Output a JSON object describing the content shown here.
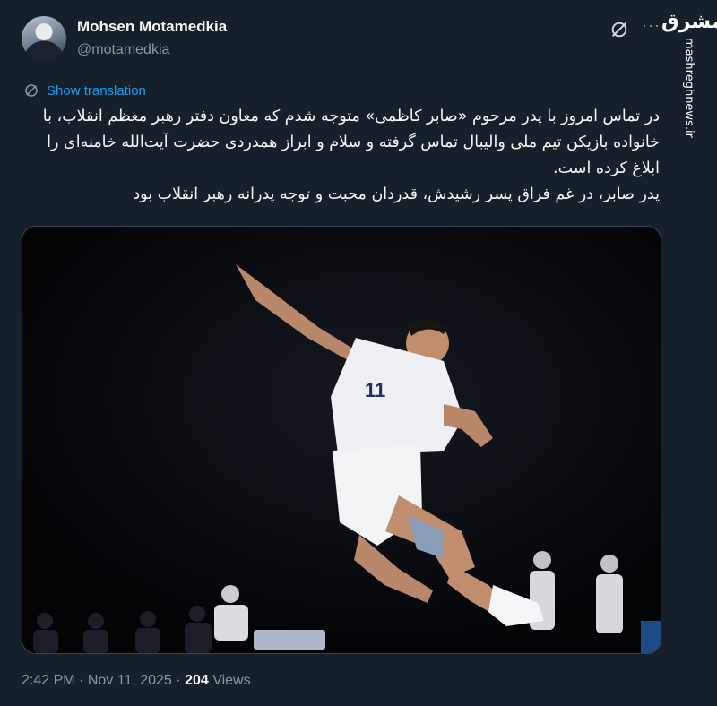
{
  "author": {
    "name": "Mohsen Motamedkia",
    "handle": "@motamedkia"
  },
  "watermark": {
    "logo": "مشرق",
    "site": "mashreghnews.ir"
  },
  "actions": {
    "grok_icon": "grok-icon",
    "more_icon": "more-icon",
    "more_label": "···"
  },
  "translate": {
    "icon": "globe-icon",
    "label": "Show translation"
  },
  "tweet": {
    "paragraph1": "در تماس امروز با پدر مرحوم «صابر کاظمی» متوجه شدم که معاون دفتر رهبر معظم انقلاب، با خانواده بازیکن تیم ملی والیبال تماس گرفته و سلام و ابراز همدردی حضرت آیت‌الله خامنه‌ای را ابلاغ کرده است.",
    "paragraph2": "پدر صابر، در غم فراق پسر رشیدش، قدردان محبت و توجه پدرانه رهبر انقلاب بود"
  },
  "media": {
    "jersey_number": "11"
  },
  "meta": {
    "time": "2:42 PM",
    "date": "Nov 11, 2025",
    "views_count": "204",
    "views_label": "Views",
    "separator": "·"
  },
  "colors": {
    "background": "#15202b",
    "link": "#1d9bf0",
    "muted": "#8b98a5"
  }
}
